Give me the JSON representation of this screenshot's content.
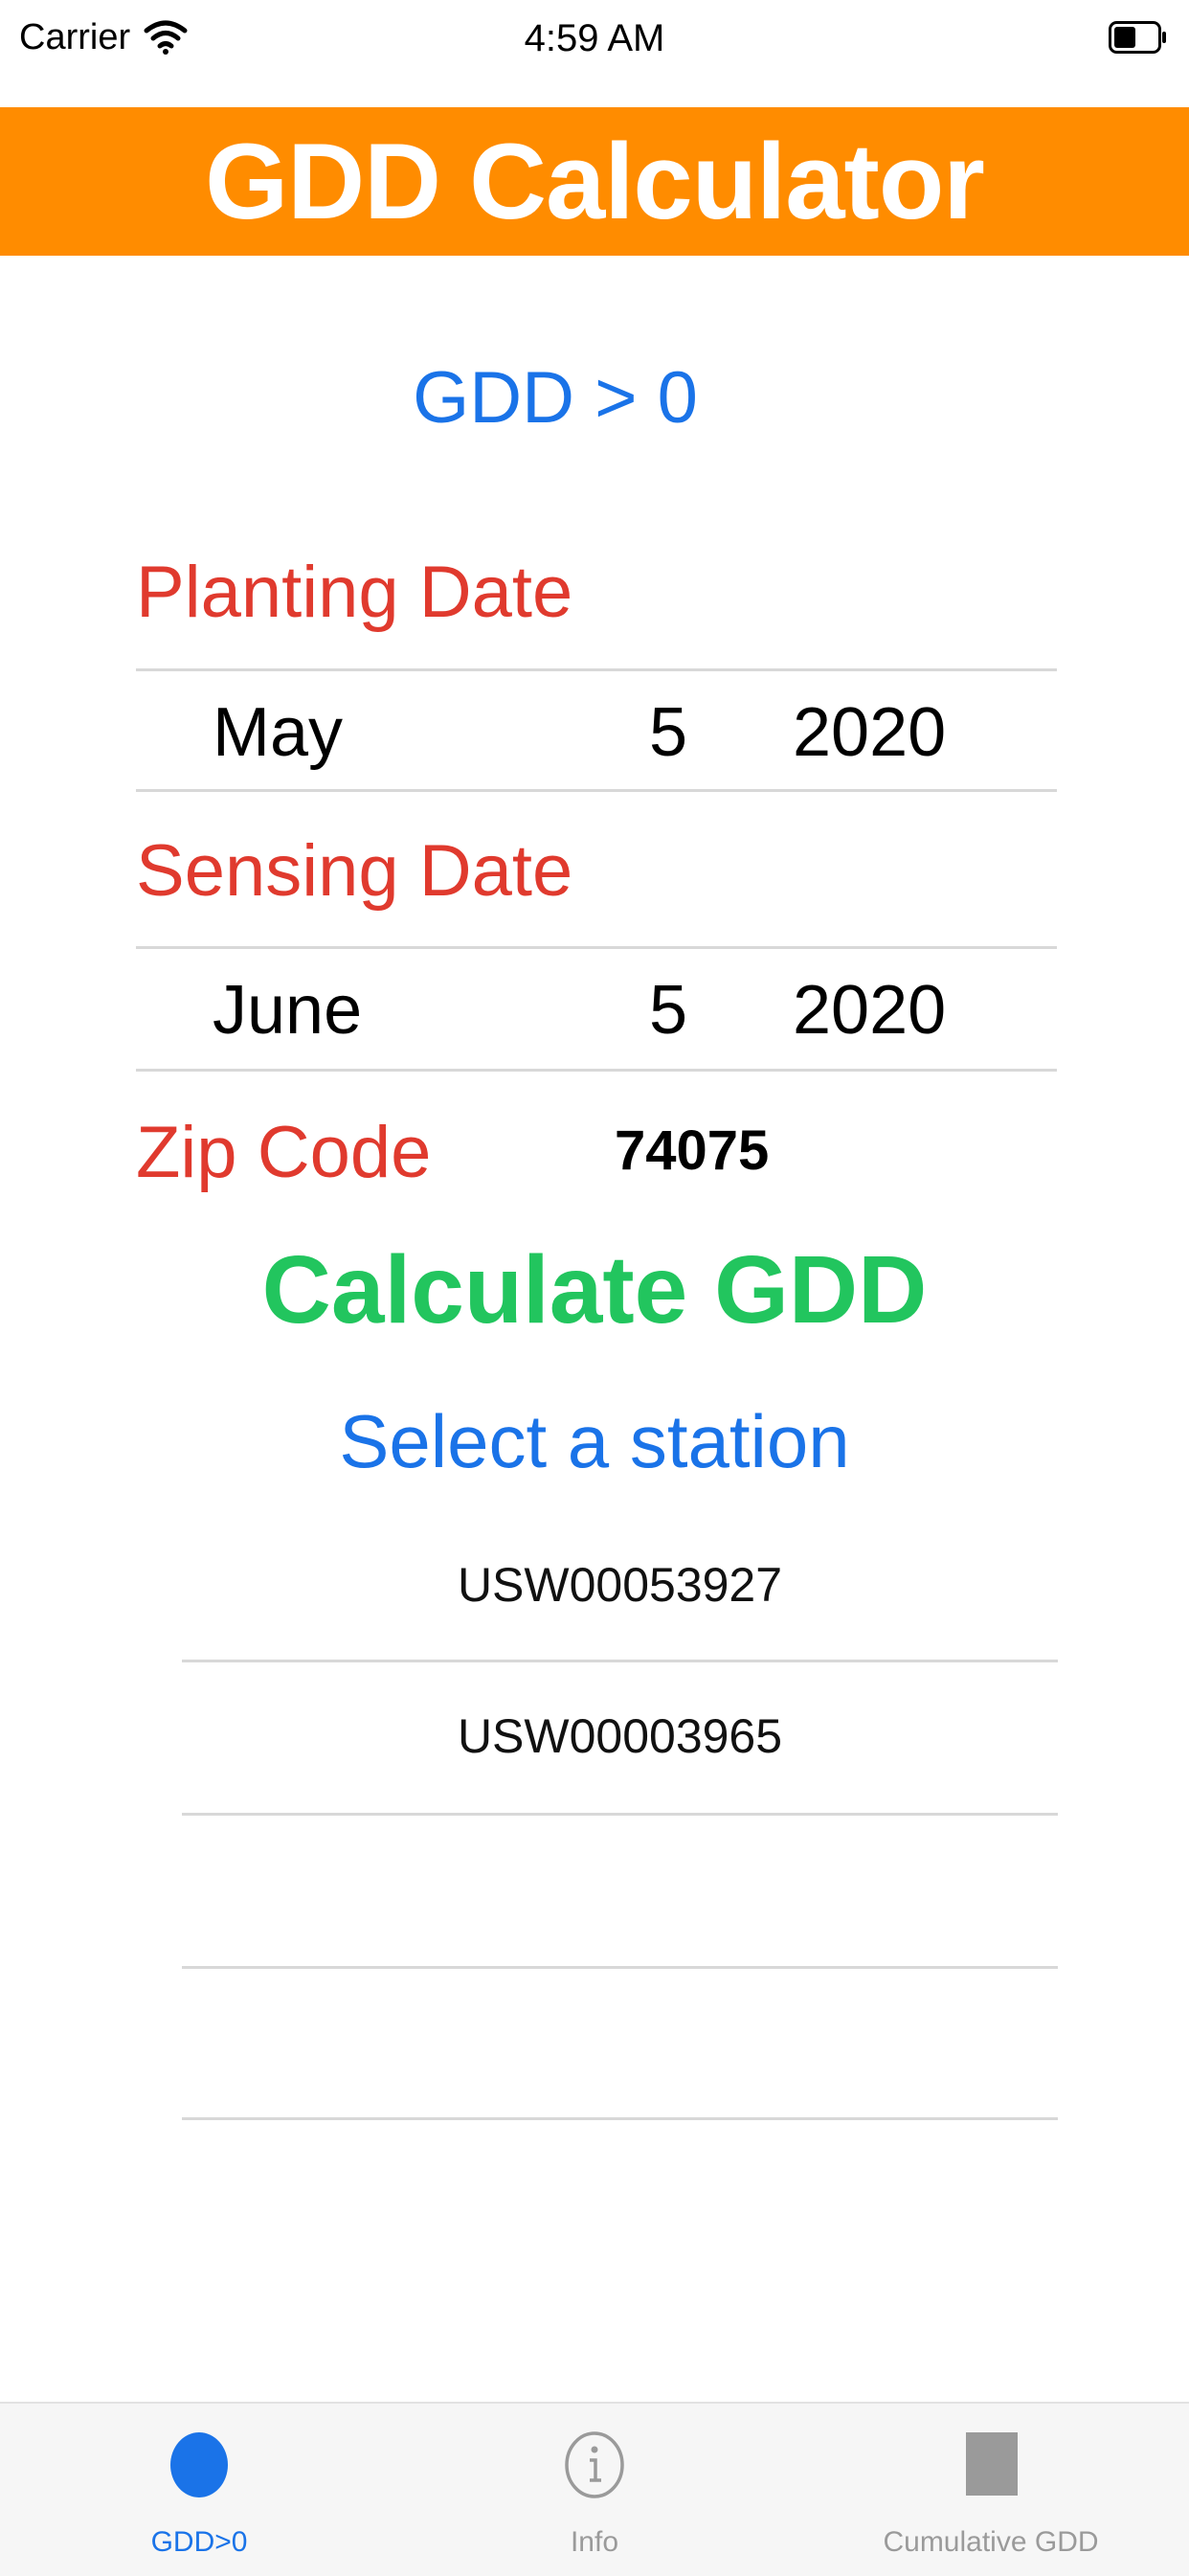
{
  "status_bar": {
    "carrier": "Carrier",
    "time": "4:59 AM"
  },
  "header": {
    "title": "GDD Calculator"
  },
  "mode_label": "GDD > 0",
  "planting_date": {
    "label": "Planting Date",
    "month": "May",
    "day": "5",
    "year": "2020"
  },
  "sensing_date": {
    "label": "Sensing Date",
    "month": "June",
    "day": "5",
    "year": "2020"
  },
  "zip": {
    "label": "Zip Code",
    "value": "74075"
  },
  "calculate_button": "Calculate GDD",
  "select_station_label": "Select a station",
  "stations": [
    "USW00053927",
    "USW00003965"
  ],
  "tabs": [
    {
      "label": "GDD>0",
      "icon": "circle-icon",
      "active": true
    },
    {
      "label": "Info",
      "icon": "info-icon",
      "active": false
    },
    {
      "label": "Cumulative GDD",
      "icon": "square-icon",
      "active": false
    }
  ],
  "colors": {
    "header_bg": "#ff8c00",
    "blue": "#1a73e8",
    "red": "#e03a2e",
    "green": "#22c55e",
    "tab_active": "#1a73e8",
    "tab_inactive": "#9a9a9a"
  }
}
